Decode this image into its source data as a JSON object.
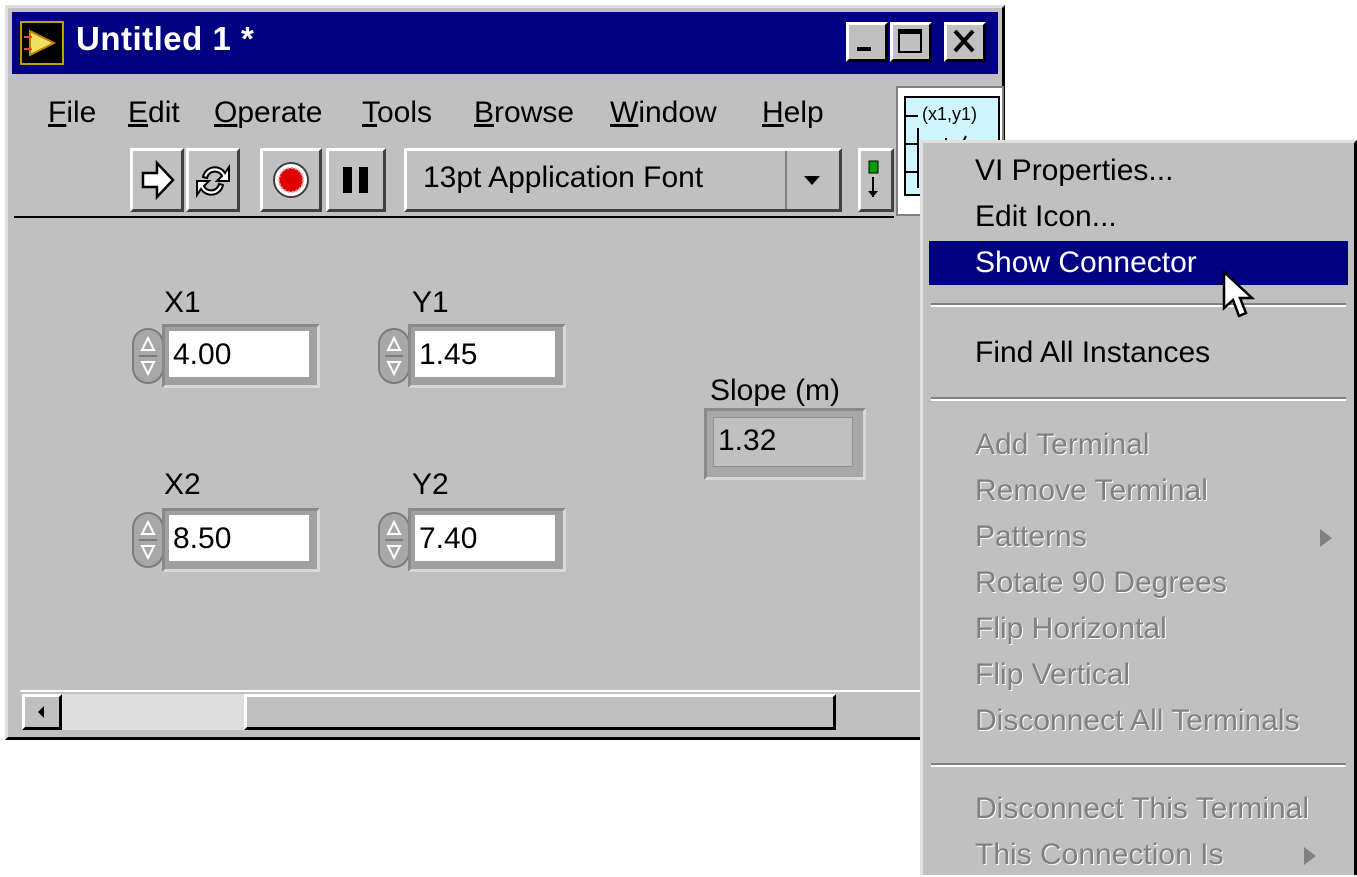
{
  "window": {
    "title": "Untitled 1 *",
    "controls": [
      "minimize-icon",
      "maximize-icon",
      "close-icon"
    ]
  },
  "menubar": {
    "items": [
      {
        "mnemonic": "F",
        "rest": "ile"
      },
      {
        "mnemonic": "E",
        "rest": "dit"
      },
      {
        "mnemonic": "O",
        "rest": "perate"
      },
      {
        "mnemonic": "T",
        "rest": "ools"
      },
      {
        "mnemonic": "B",
        "rest": "rowse"
      },
      {
        "mnemonic": "W",
        "rest": "indow"
      },
      {
        "mnemonic": "H",
        "rest": "elp"
      }
    ]
  },
  "toolbar": {
    "font_ring": "13pt Application Font",
    "buttons": [
      "run-arrow-icon",
      "run-continuously-icon",
      "abort-icon",
      "pause-icon",
      "align-objects-icon"
    ]
  },
  "connector_pane": {
    "label": "(x1,y1)",
    "color": "#cff5ff"
  },
  "front_panel": {
    "controls": [
      {
        "label": "X1",
        "value": "4.00"
      },
      {
        "label": "Y1",
        "value": "1.45"
      },
      {
        "label": "X2",
        "value": "8.50"
      },
      {
        "label": "Y2",
        "value": "7.40"
      }
    ],
    "indicator": {
      "label": "Slope (m)",
      "value": "1.32"
    }
  },
  "context_menu": {
    "group1": [
      "VI Properties...",
      "Edit Icon...",
      "Show Connector"
    ],
    "highlighted": "Show Connector",
    "group2": [
      "Find All Instances"
    ],
    "group3": [
      "Add Terminal",
      "Remove Terminal",
      "Patterns",
      "Rotate 90 Degrees",
      "Flip Horizontal",
      "Flip Vertical",
      "Disconnect All Terminals"
    ],
    "group4": [
      "Disconnect This Terminal",
      "This Connection Is"
    ]
  },
  "colors": {
    "titlebar": "#000080",
    "face": "#c0c0c0",
    "highlight": "#000080",
    "disabled_text": "#808080"
  }
}
